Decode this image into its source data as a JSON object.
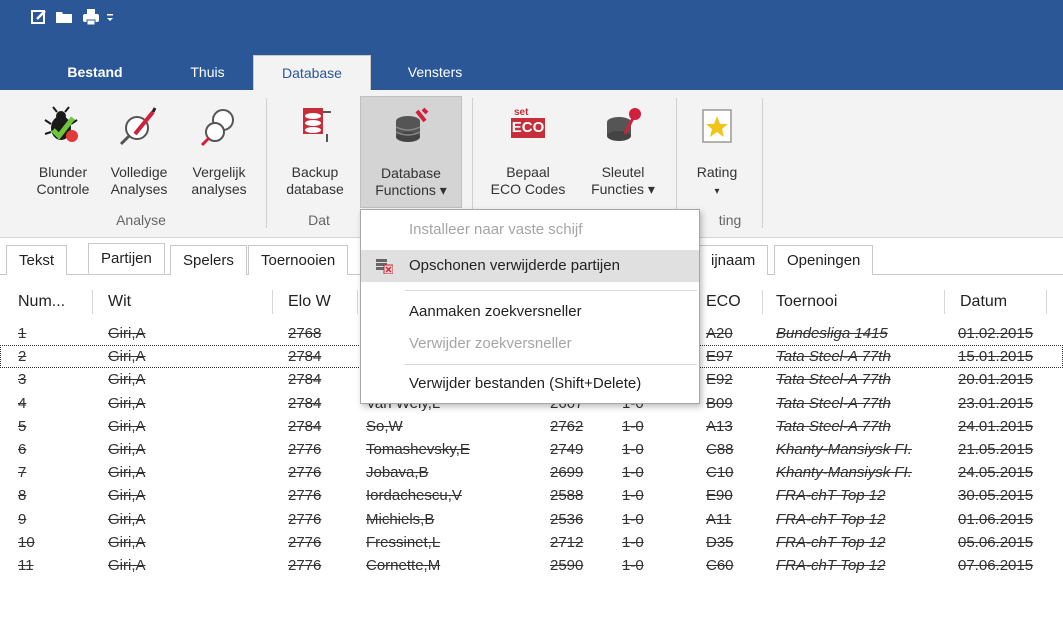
{
  "quick_access": [
    "new-icon",
    "open-folder-icon",
    "print-icon",
    "customize-icon"
  ],
  "ribbon_tabs": [
    {
      "label": "Bestand"
    },
    {
      "label": "Thuis"
    },
    {
      "label": "Database"
    },
    {
      "label": "Vensters"
    }
  ],
  "ribbon": {
    "buttons": [
      {
        "line1": "Blunder",
        "line2": "Controle"
      },
      {
        "line1": "Volledige",
        "line2": "Analyses"
      },
      {
        "line1": "Vergelijk",
        "line2": "analyses"
      },
      {
        "line1": "Backup",
        "line2": "database"
      },
      {
        "line1": "Database",
        "line2": "Functions ▾"
      },
      {
        "line1": "Bepaal",
        "line2": "ECO Codes"
      },
      {
        "line1": "Sleutel",
        "line2": "Functies ▾"
      },
      {
        "line1": "Rating",
        "line2": "▾"
      }
    ],
    "groups": [
      "Analyse",
      "Dat",
      "ting"
    ],
    "eco_icon_text": {
      "small": "set",
      "big": "ECO"
    }
  },
  "doc_tabs": [
    {
      "label": "Tekst"
    },
    {
      "label": "Partijen"
    },
    {
      "label": "Spelers"
    },
    {
      "label": "Toernooien"
    },
    {
      "label": "ijnaam"
    },
    {
      "label": "Openingen"
    }
  ],
  "menu": {
    "items": [
      {
        "label": "Installeer naar vaste schijf",
        "disabled": true
      },
      {
        "label": "Opschonen verwijderde partijen",
        "disabled": false,
        "highlighted": true
      },
      {
        "label": "Aanmaken zoekversneller",
        "disabled": false
      },
      {
        "label": "Verwijder zoekversneller",
        "disabled": true
      },
      {
        "label": "Verwijder bestanden (Shift+Delete)",
        "disabled": false
      }
    ]
  },
  "table": {
    "headers": [
      "Num...",
      "Wit",
      "Elo W",
      "ECO",
      "Toernooi",
      "Datum"
    ],
    "rows": [
      {
        "num": "1",
        "wit": "Giri,A",
        "elow": "2768",
        "zwart": "",
        "eloz": "",
        "res": "",
        "eco": "A20",
        "toernooi": "Bundesliga 1415",
        "datum": "01.02.2015"
      },
      {
        "num": "2",
        "wit": "Giri,A",
        "elow": "2784",
        "zwart": "",
        "eloz": "",
        "res": "",
        "eco": "E97",
        "toernooi": "Tata Steel-A 77th",
        "datum": "15.01.2015"
      },
      {
        "num": "3",
        "wit": "Giri,A",
        "elow": "2784",
        "zwart": "",
        "eloz": "",
        "res": "",
        "eco": "E92",
        "toernooi": "Tata Steel-A 77th",
        "datum": "20.01.2015"
      },
      {
        "num": "4",
        "wit": "Giri,A",
        "elow": "2784",
        "zwart": "Van Wely,L",
        "eloz": "2667",
        "res": "1-0",
        "eco": "B09",
        "toernooi": "Tata Steel-A 77th",
        "datum": "23.01.2015"
      },
      {
        "num": "5",
        "wit": "Giri,A",
        "elow": "2784",
        "zwart": "So,W",
        "eloz": "2762",
        "res": "1-0",
        "eco": "A13",
        "toernooi": "Tata Steel-A 77th",
        "datum": "24.01.2015"
      },
      {
        "num": "6",
        "wit": "Giri,A",
        "elow": "2776",
        "zwart": "Tomashevsky,E",
        "eloz": "2749",
        "res": "1-0",
        "eco": "C88",
        "toernooi": "Khanty-Mansiysk FI.",
        "datum": "21.05.2015"
      },
      {
        "num": "7",
        "wit": "Giri,A",
        "elow": "2776",
        "zwart": "Jobava,B",
        "eloz": "2699",
        "res": "1-0",
        "eco": "C10",
        "toernooi": "Khanty-Mansiysk FI.",
        "datum": "24.05.2015"
      },
      {
        "num": "8",
        "wit": "Giri,A",
        "elow": "2776",
        "zwart": "Iordachescu,V",
        "eloz": "2588",
        "res": "1-0",
        "eco": "E90",
        "toernooi": "FRA-chT Top 12",
        "datum": "30.05.2015"
      },
      {
        "num": "9",
        "wit": "Giri,A",
        "elow": "2776",
        "zwart": "Michiels,B",
        "eloz": "2536",
        "res": "1-0",
        "eco": "A11",
        "toernooi": "FRA-chT Top 12",
        "datum": "01.06.2015"
      },
      {
        "num": "10",
        "wit": "Giri,A",
        "elow": "2776",
        "zwart": "Fressinet,L",
        "eloz": "2712",
        "res": "1-0",
        "eco": "D35",
        "toernooi": "FRA-chT Top 12",
        "datum": "05.06.2015"
      },
      {
        "num": "11",
        "wit": "Giri,A",
        "elow": "2776",
        "zwart": "Cornette,M",
        "eloz": "2590",
        "res": "1-0",
        "eco": "C60",
        "toernooi": "FRA-chT Top 12",
        "datum": "07.06.2015"
      }
    ]
  },
  "colors": {
    "ribbon_blue": "#2b5797",
    "ribbon_bg": "#f3f3f3"
  }
}
